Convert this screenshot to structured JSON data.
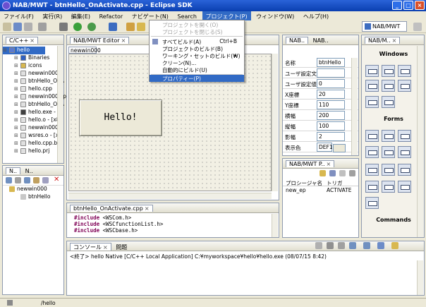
{
  "window": {
    "title": "NAB/MWT - btnHello_OnActivate.cpp - Eclipse SDK",
    "min": "_",
    "max": "□",
    "close": "×"
  },
  "menu": [
    "ファイル(F)",
    "実行(R)",
    "編集(E)",
    "Refactor",
    "ナビゲート(N)",
    "Search",
    "プロジェクト(P)",
    "ウィンドウ(W)",
    "ヘルプ(H)"
  ],
  "perspective": {
    "label": "NAB/MWT"
  },
  "project_menu": {
    "items": [
      {
        "label": "プロジェクトを開く(O)",
        "shortcut": "",
        "disabled": true
      },
      {
        "label": "プロジェクトを閉じる(S)",
        "shortcut": "",
        "disabled": true
      },
      {
        "label": "すべてビルド(A)",
        "shortcut": "Ctrl+B",
        "disabled": false
      },
      {
        "label": "プロジェクトのビルド(B)",
        "shortcut": "",
        "disabled": false
      },
      {
        "label": "ワーキング・セットのビルド(W)",
        "shortcut": "▸",
        "disabled": false
      },
      {
        "label": "クリーン(N)...",
        "shortcut": "",
        "disabled": false
      },
      {
        "label": "自動的にビルド(U)",
        "shortcut": "",
        "disabled": false
      },
      {
        "label": "プロパティー(P)",
        "shortcut": "",
        "disabled": false
      }
    ]
  },
  "cpp_view": {
    "tab": "C/C++",
    "tree": [
      {
        "label": "hello",
        "depth": 0,
        "icon": "project-icon"
      },
      {
        "label": "Binaries",
        "depth": 1,
        "icon": "binaries-icon"
      },
      {
        "label": "icons",
        "depth": 1,
        "icon": "folder-icon"
      },
      {
        "label": "newwin000",
        "depth": 1,
        "icon": "file-icon"
      },
      {
        "label": "btnHello_OnA",
        "depth": 1,
        "icon": "file-icon"
      },
      {
        "label": "hello.cpp",
        "depth": 1,
        "icon": "file-icon"
      },
      {
        "label": "newwin000.cp",
        "depth": 1,
        "icon": "file-icon"
      },
      {
        "label": "btnHello_OnA",
        "depth": 1,
        "icon": "file-icon"
      },
      {
        "label": "hello.exe - [x",
        "depth": 1,
        "icon": "exe-icon"
      },
      {
        "label": "hello.o - [x86",
        "depth": 1,
        "icon": "file-icon"
      },
      {
        "label": "newwin000.o",
        "depth": 1,
        "icon": "file-icon"
      },
      {
        "label": "wsres.o - [x8",
        "depth": 1,
        "icon": "file-icon"
      },
      {
        "label": "hello.cpp.bak",
        "depth": 1,
        "icon": "file-icon"
      },
      {
        "label": "hello.prj",
        "depth": 1,
        "icon": "file-icon"
      }
    ]
  },
  "nav_view": {
    "tabs": [
      "N..",
      "N.."
    ],
    "tree": [
      {
        "label": "newwin000"
      },
      {
        "label": "btnHello"
      }
    ]
  },
  "editor": {
    "tab": "NAB/MWT Editor",
    "inner_tab": "newwin000",
    "button_text": "Hello!"
  },
  "code_editor": {
    "tab": "btnHello_OnActivate.cpp",
    "lines": [
      {
        "kw": "#include",
        "text": " <WSCom.h>"
      },
      {
        "kw": "#include",
        "text": " <WSCfunctionList.h>"
      },
      {
        "kw": "#include",
        "text": " <WSCbase.h>"
      }
    ]
  },
  "properties": {
    "tabs": [
      "NAB..",
      "NAB.."
    ],
    "rows": [
      {
        "key": "名称",
        "value": "btnHello"
      },
      {
        "key": "ユーザ設定文字",
        "value": ""
      },
      {
        "key": "ユーザ設定値",
        "value": "0"
      },
      {
        "key": "X座標",
        "value": "20"
      },
      {
        "key": "Y座標",
        "value": "110"
      },
      {
        "key": "横幅",
        "value": "200"
      },
      {
        "key": "縦幅",
        "value": "100"
      },
      {
        "key": "影幅",
        "value": "2"
      },
      {
        "key": "表示色",
        "value": "DEF14"
      }
    ]
  },
  "procedure_view": {
    "tab": "NAB/MWT P..",
    "headers": [
      "プロシージャ名",
      "トリガ"
    ],
    "rows": [
      {
        "name": "new_ep",
        "trigger": "ACTIVATE"
      }
    ]
  },
  "palette": {
    "tab": "NAB/M..",
    "sections": [
      "Windows",
      "Forms",
      "Commands"
    ]
  },
  "console": {
    "tabs": [
      "コンソール",
      "問題"
    ],
    "text": "<終了> hello Native [C/C++ Local Application] C:¥myworkspace¥hello¥hello.exe (08/07/15 8:42)"
  },
  "status": {
    "path": "/hello"
  }
}
